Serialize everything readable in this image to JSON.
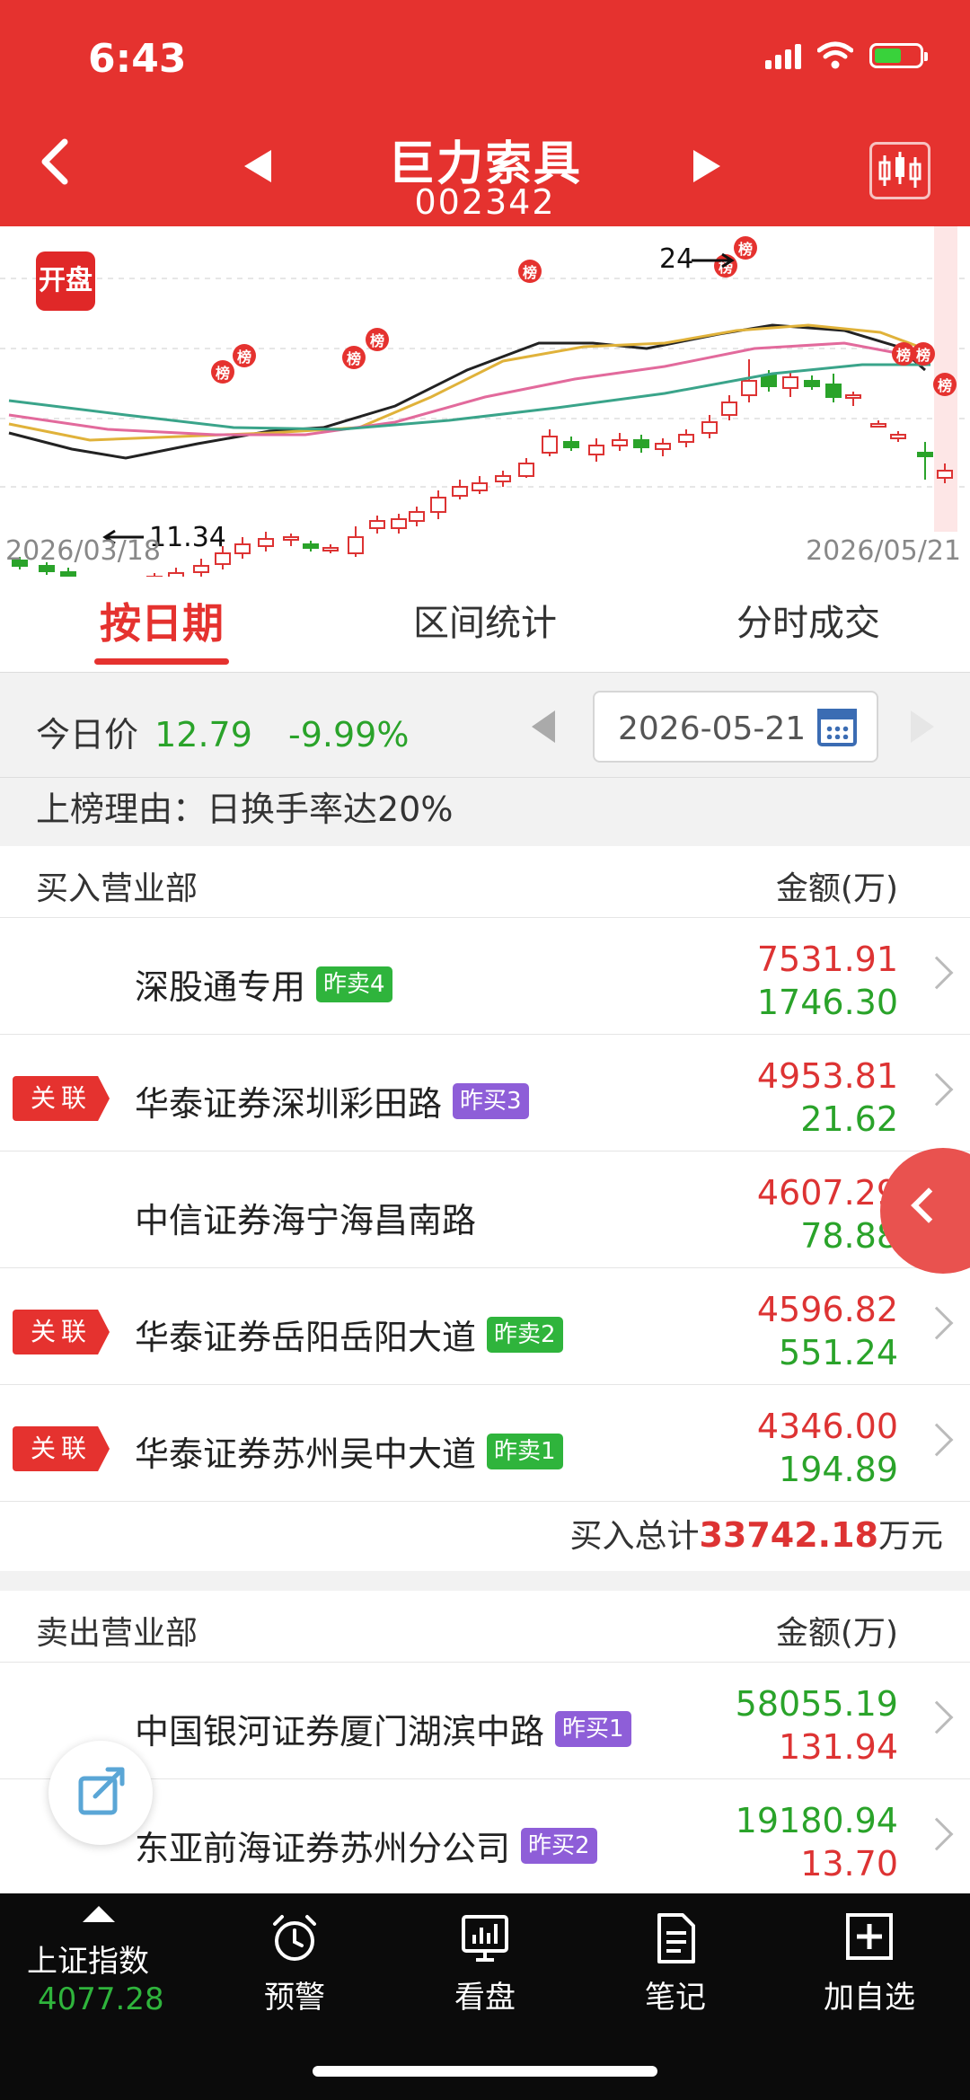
{
  "status": {
    "time": "6:43"
  },
  "header": {
    "title": "巨力索具",
    "code": "002342"
  },
  "chart": {
    "badge": "开盘",
    "date_start": "2026/03/18",
    "date_end": "2026/05/21",
    "high_label": "24",
    "low_label": "11.34",
    "list_marker": "榜"
  },
  "chart_data": {
    "type": "candlestick",
    "x_range": [
      "2026/03/18",
      "2026/05/21"
    ],
    "annotations": [
      {
        "text": "24",
        "meaning": "high"
      },
      {
        "text": "11.34",
        "meaning": "low"
      }
    ],
    "series": [
      {
        "name": "MA5",
        "color": "#222222"
      },
      {
        "name": "MA10",
        "color": "#e0b23a"
      },
      {
        "name": "MA20",
        "color": "#e26a9c"
      },
      {
        "name": "MA60",
        "color": "#3aa48a"
      }
    ]
  },
  "tabs": [
    {
      "label": "按日期",
      "active": true
    },
    {
      "label": "区间统计",
      "active": false
    },
    {
      "label": "分时成交",
      "active": false
    }
  ],
  "price": {
    "label": "今日价",
    "value": "12.79",
    "change": "-9.99%",
    "date": "2026-05-21"
  },
  "reason": "上榜理由：日换手率达20%",
  "buy": {
    "header_left": "买入营业部",
    "header_right": "金额(万)",
    "rows": [
      {
        "related": false,
        "name": "深股通专用",
        "badge": "昨卖4",
        "badge_color": "green",
        "amt1": "7531.91",
        "amt2": "1746.30"
      },
      {
        "related": true,
        "name": "华泰证券深圳彩田路",
        "badge": "昨买3",
        "badge_color": "purple",
        "amt1": "4953.81",
        "amt2": "21.62"
      },
      {
        "related": false,
        "name": "中信证券海宁海昌南路",
        "badge": "",
        "badge_color": "",
        "amt1": "4607.29",
        "amt2": "78.88"
      },
      {
        "related": true,
        "name": "华泰证券岳阳岳阳大道",
        "badge": "昨卖2",
        "badge_color": "green",
        "amt1": "4596.82",
        "amt2": "551.24"
      },
      {
        "related": true,
        "name": "华泰证券苏州吴中大道",
        "badge": "昨卖1",
        "badge_color": "green",
        "amt1": "4346.00",
        "amt2": "194.89"
      }
    ],
    "total_label": "买入总计",
    "total_value": "33742.18",
    "total_unit": "万元"
  },
  "related_tag": "关联",
  "sell": {
    "header_left": "卖出营业部",
    "header_right": "金额(万)",
    "rows": [
      {
        "name": "中国银河证券厦门湖滨中路",
        "badge": "昨买1",
        "badge_color": "purple",
        "amt1": "58055.19",
        "amt2": "131.94"
      },
      {
        "name": "东亚前海证券苏州分公司",
        "badge": "昨买2",
        "badge_color": "purple",
        "amt1": "19180.94",
        "amt2": "13.70"
      }
    ]
  },
  "bottom": {
    "index_name": "上证指数",
    "index_value": "4077.28",
    "items": [
      "预警",
      "看盘",
      "笔记",
      "加自选"
    ]
  },
  "colors": {
    "brand": "#e5322f",
    "up": "#dd3333",
    "down": "#2aa32a"
  }
}
